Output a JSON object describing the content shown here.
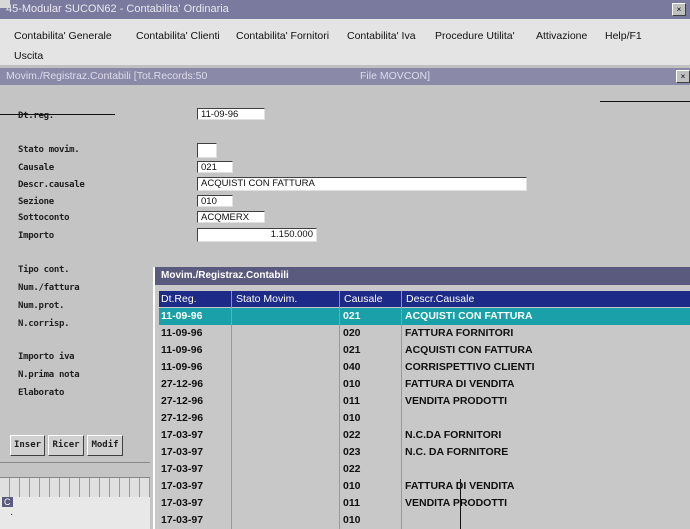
{
  "window": {
    "title": "45-Modular SUCON62 - Contabilita' Ordinaria",
    "close_glyph": "×"
  },
  "menu": {
    "items": [
      "Contabilita' Generale",
      "Contabilita' Clienti",
      "Contabilita' Fornitori",
      "Contabilita' Iva",
      "Procedure Utilita'",
      "Attivazione",
      "Help/F1"
    ],
    "exit_label": "Uscita"
  },
  "subwindow": {
    "title": "Movim./Registraz.Contabili [Tot.Records:50",
    "file": "File MOVCON]",
    "close_glyph": "×"
  },
  "form": {
    "labels": {
      "dt_reg": "Dt.reg.",
      "stato": "Stato movim.",
      "causale": "Causale",
      "descr_causale": "Descr.causale",
      "sezione": "Sezione",
      "sottoconto": "Sottoconto",
      "importo": "Importo",
      "tipo_cont": "Tipo cont.",
      "num_fattura": "Num./fattura",
      "num_prot": "Num.prot.",
      "corrisp": "N.corrisp.",
      "importo_iva": "Importo iva",
      "prima_nota": "N.prima nota",
      "elaborato": "Elaborato"
    },
    "values": {
      "dt_reg": "11-09-96",
      "stato": "",
      "causale": "021",
      "descr_causale": "ACQUISTI CON FATTURA",
      "sezione": "010",
      "sottoconto": "ACQMERX",
      "importo": "1.150.000"
    }
  },
  "buttons": {
    "inser": "Inser",
    "ricer": "Ricer",
    "modif": "Modif"
  },
  "status": {
    "left": "C",
    "bottom": "·"
  },
  "popup": {
    "title": "Movim./Registraz.Contabili",
    "columns": [
      "Dt.Reg.",
      "Stato Movim.",
      "Causale",
      "Descr.Causale"
    ],
    "rows": [
      {
        "date": "11-09-96",
        "stato": "",
        "causale": "021",
        "descr": "ACQUISTI CON FATTURA",
        "selected": true
      },
      {
        "date": "11-09-96",
        "stato": "",
        "causale": "020",
        "descr": "FATTURA FORNITORI"
      },
      {
        "date": "11-09-96",
        "stato": "",
        "causale": "021",
        "descr": "ACQUISTI CON FATTURA"
      },
      {
        "date": "11-09-96",
        "stato": "",
        "causale": "040",
        "descr": "CORRISPETTIVO CLIENTI"
      },
      {
        "date": "27-12-96",
        "stato": "",
        "causale": "010",
        "descr": "FATTURA DI VENDITA"
      },
      {
        "date": "27-12-96",
        "stato": "",
        "causale": "011",
        "descr": "VENDITA PRODOTTI"
      },
      {
        "date": "27-12-96",
        "stato": "",
        "causale": "010",
        "descr": ""
      },
      {
        "date": "17-03-97",
        "stato": "",
        "causale": "022",
        "descr": "N.C.DA FORNITORI"
      },
      {
        "date": "17-03-97",
        "stato": "",
        "causale": "023",
        "descr": "N.C. DA FORNITORE"
      },
      {
        "date": "17-03-97",
        "stato": "",
        "causale": "022",
        "descr": ""
      },
      {
        "date": "17-03-97",
        "stato": "",
        "causale": "010",
        "descr": "FATTURA DI VENDITA"
      },
      {
        "date": "17-03-97",
        "stato": "",
        "causale": "011",
        "descr": "VENDITA PRODOTTI"
      },
      {
        "date": "17-03-97",
        "stato": "",
        "causale": "010",
        "descr": ""
      }
    ]
  },
  "colors": {
    "selected_row": "#19a0a8",
    "header": "#1d2a88",
    "title_bar": "#7a7a9e"
  }
}
